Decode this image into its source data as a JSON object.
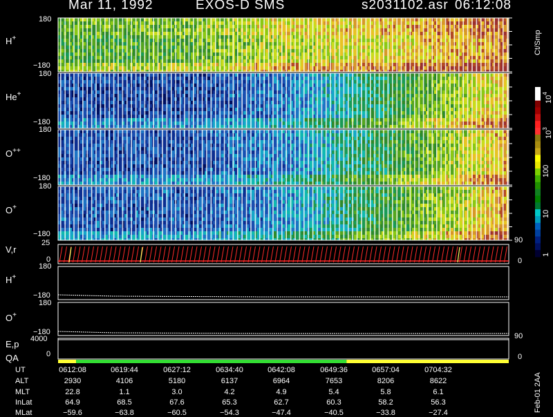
{
  "header": {
    "date": "Mar 11, 1992",
    "instrument": "EXOS-D SMS",
    "file": "s2031102.asr",
    "time": "06:12:08"
  },
  "panels": [
    {
      "species": "H",
      "charge": "+",
      "ymax": "180",
      "ymin": "−180"
    },
    {
      "species": "He",
      "charge": "+",
      "ymax": "180",
      "ymin": "−180"
    },
    {
      "species": "O",
      "charge": "++",
      "ymax": "180",
      "ymin": "−180"
    },
    {
      "species": "O",
      "charge": "+",
      "ymax": "180",
      "ymin": "−180"
    }
  ],
  "vr_panel": {
    "label": "V,r",
    "ymax": "25",
    "ymin": "0",
    "right_max": "90",
    "right_min": "0"
  },
  "h_line_panel": {
    "species": "H",
    "charge": "+",
    "ymax": "180",
    "ymin": "−180"
  },
  "o_line_panel": {
    "species": "O",
    "charge": "+",
    "ymax": "180",
    "ymin": "−180"
  },
  "ep_panel": {
    "label1": "E,p",
    "label2": "QA",
    "ymax": "4000",
    "ymin": "0",
    "right_max": "90",
    "right_min": "0"
  },
  "colorbar": {
    "unit": "Ct/Smp",
    "tick_labels": [
      "10^4",
      "10^3",
      "100",
      "10",
      "1"
    ],
    "colors": [
      "#ffffff",
      "#ffffff",
      "#800000",
      "#a00000",
      "#c81010",
      "#ff2020",
      "#ff3030",
      "#8c7a10",
      "#a88c10",
      "#c8a818",
      "#ffff00",
      "#e8e800",
      "#7cd000",
      "#40b000",
      "#209000",
      "#108020",
      "#008000",
      "#007830",
      "#00c8c8",
      "#00a0c0",
      "#0060c0",
      "#0040a0",
      "#002080",
      "#001060",
      "#000030"
    ]
  },
  "spectrogram": {
    "palette": [
      "#001060",
      "#0d2e90",
      "#1a4fb0",
      "#1d74c4",
      "#16a6c9",
      "#10b9b0",
      "#1a9a55",
      "#2f8a2b",
      "#55a51e",
      "#8bc814",
      "#c9dc1c",
      "#e8c324",
      "#d7972a",
      "#b34a25",
      "#9a3030"
    ],
    "panel_intensity_profiles": [
      [
        [
          0,
          0.52
        ],
        [
          0.25,
          0.55
        ],
        [
          0.5,
          0.68
        ],
        [
          0.75,
          0.74
        ],
        [
          1,
          0.85
        ]
      ],
      [
        [
          0,
          0.15
        ],
        [
          0.3,
          0.13
        ],
        [
          0.5,
          0.22
        ],
        [
          0.65,
          0.38
        ],
        [
          0.8,
          0.55
        ],
        [
          1,
          0.78
        ]
      ],
      [
        [
          0,
          0.16
        ],
        [
          0.3,
          0.15
        ],
        [
          0.5,
          0.24
        ],
        [
          0.65,
          0.4
        ],
        [
          0.8,
          0.55
        ],
        [
          1,
          0.8
        ]
      ],
      [
        [
          0,
          0.17
        ],
        [
          0.3,
          0.16
        ],
        [
          0.5,
          0.26
        ],
        [
          0.65,
          0.42
        ],
        [
          0.8,
          0.57
        ],
        [
          1,
          0.82
        ]
      ]
    ]
  },
  "qa_bar": [
    {
      "from": 0.0,
      "to": 0.04,
      "color": "#ffff33"
    },
    {
      "from": 0.04,
      "to": 0.64,
      "color": "#33dd33"
    },
    {
      "from": 0.64,
      "to": 1.0,
      "color": "#ffff33"
    }
  ],
  "orbit_table": {
    "row_labels": [
      "UT",
      "ALT",
      "MLT",
      "InLat",
      "MLat"
    ],
    "columns": [
      [
        "0612:08",
        "2930",
        "22.8",
        "64.9",
        "−59.6"
      ],
      [
        "0619:44",
        "4106",
        "1.1",
        "68.5",
        "−63.8"
      ],
      [
        "0627:12",
        "5180",
        "3.0",
        "67.6",
        "−60.5"
      ],
      [
        "0634:40",
        "6137",
        "4.2",
        "65.3",
        "−54.3"
      ],
      [
        "0642:08",
        "6964",
        "4.9",
        "62.7",
        "−47.4"
      ],
      [
        "0649:36",
        "7653",
        "5.4",
        "60.3",
        "−40.5"
      ],
      [
        "0657:04",
        "8206",
        "5.8",
        "58.2",
        "−33.8"
      ],
      [
        "0704:32",
        "8622",
        "6.1",
        "56.3",
        "−27.4"
      ]
    ]
  },
  "side_note": "Feb-01 2AA"
}
